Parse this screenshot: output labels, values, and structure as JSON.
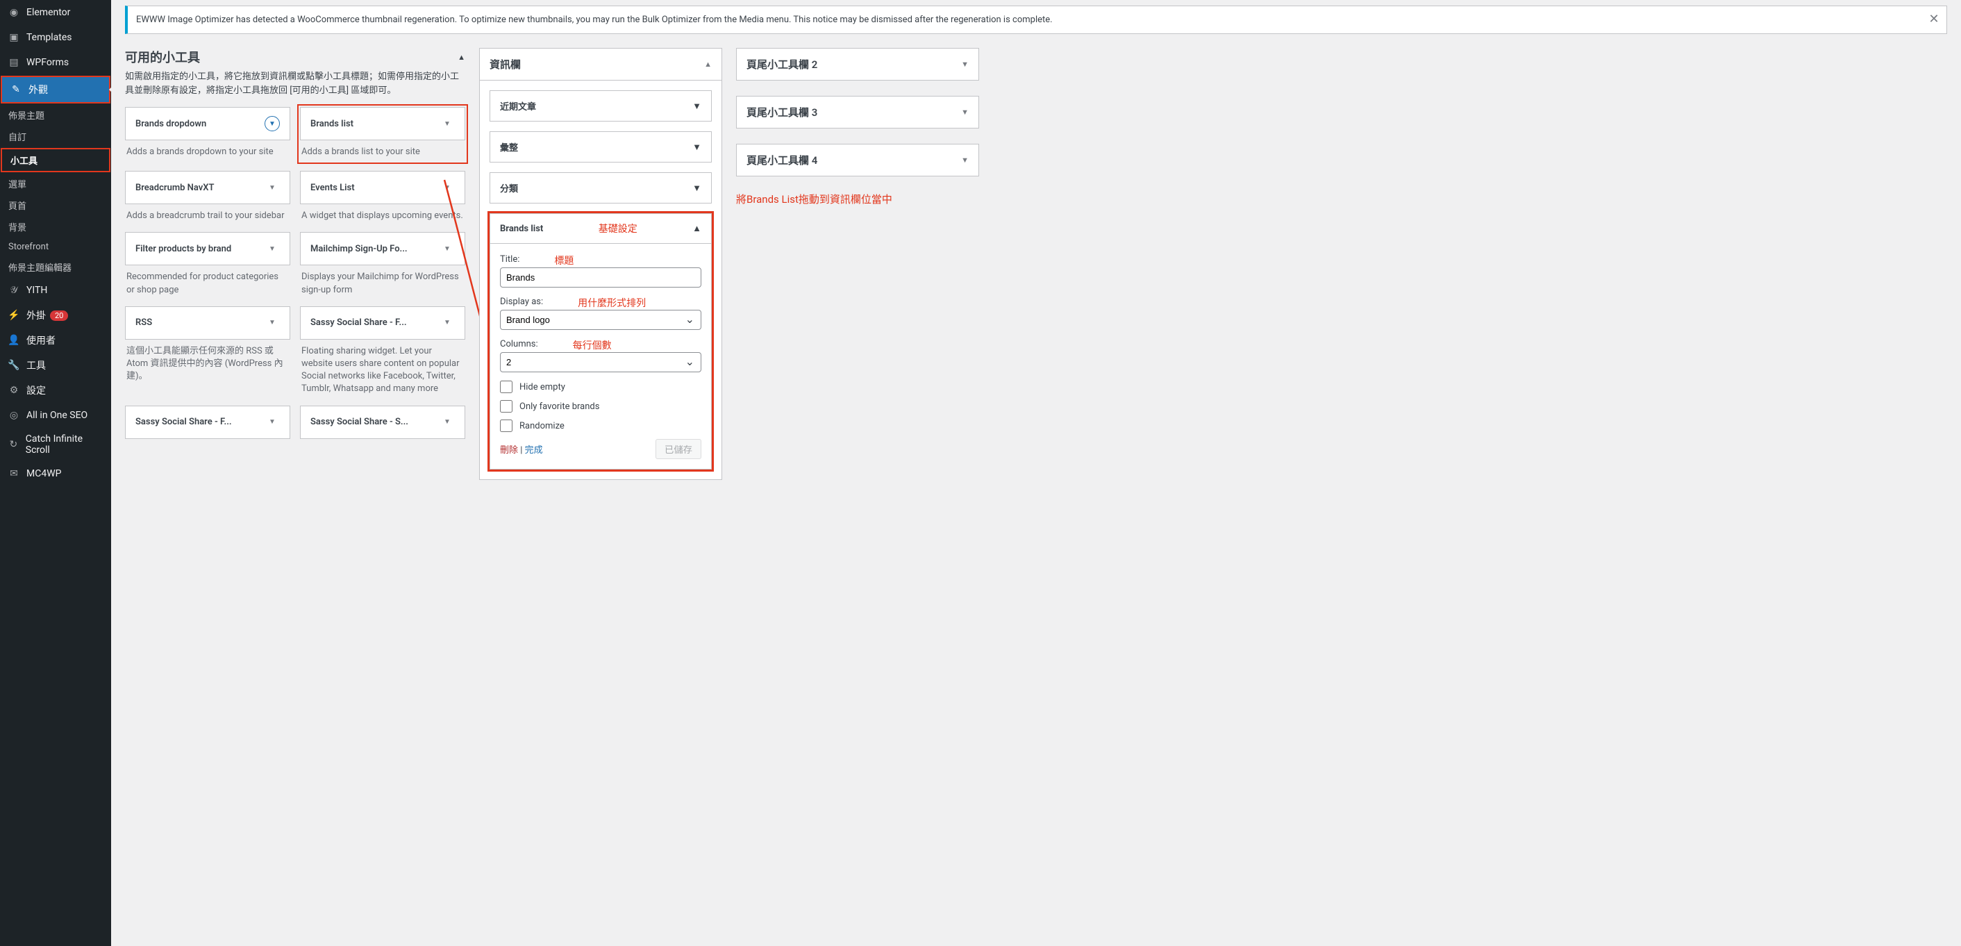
{
  "sidebar": {
    "items": [
      {
        "label": "Elementor",
        "icon": "◉"
      },
      {
        "label": "Templates",
        "icon": "▣"
      },
      {
        "label": "WPForms",
        "icon": "▤"
      }
    ],
    "appearance": {
      "label": "外觀",
      "icon": "✎"
    },
    "appearance_sub": [
      "佈景主題",
      "自訂",
      "小工具",
      "選單",
      "頁首",
      "背景",
      "Storefront",
      "佈景主題編輯器"
    ],
    "tail": [
      {
        "label": "YITH",
        "icon": "𝒴"
      },
      {
        "label": "外掛",
        "icon": "⚡",
        "badge": "20"
      },
      {
        "label": "使用者",
        "icon": "👤"
      },
      {
        "label": "工具",
        "icon": "🔧"
      },
      {
        "label": "設定",
        "icon": "⚙"
      },
      {
        "label": "All in One SEO",
        "icon": "◎"
      },
      {
        "label": "Catch Infinite Scroll",
        "icon": "↻"
      },
      {
        "label": "MC4WP",
        "icon": "✉"
      }
    ]
  },
  "notice": "EWWW Image Optimizer has detected a WooCommerce thumbnail regeneration. To optimize new thumbnails, you may run the Bulk Optimizer from the Media menu. This notice may be dismissed after the regeneration is complete.",
  "available": {
    "title": "可用的小工具",
    "desc": "如需啟用指定的小工具，將它拖放到資訊欄或點擊小工具標題；如需停用指定的小工具並刪除原有設定，將指定小工具拖放回 [可用的小工具] 區域即可。",
    "items": [
      {
        "t": "Brands dropdown",
        "d": "Adds a brands dropdown to your site"
      },
      {
        "t": "Brands list",
        "d": "Adds a brands list to your site"
      },
      {
        "t": "Breadcrumb NavXT",
        "d": "Adds a breadcrumb trail to your sidebar"
      },
      {
        "t": "Events List",
        "d": "A widget that displays upcoming events."
      },
      {
        "t": "Filter products by brand",
        "d": "Recommended for product categories or shop page"
      },
      {
        "t": "Mailchimp Sign-Up Fo...",
        "d": "Displays your Mailchimp for WordPress sign-up form"
      },
      {
        "t": "RSS",
        "d": "這個小工具能顯示任何來源的 RSS 或 Atom 資訊提供中的內容 (WordPress 內建)。"
      },
      {
        "t": "Sassy Social Share - F...",
        "d": "Floating sharing widget. Let your website users share content on popular Social networks like Facebook, Twitter, Tumblr, Whatsapp and many more"
      },
      {
        "t": "Sassy Social Share - F...",
        "d": ""
      },
      {
        "t": "Sassy Social Share - S...",
        "d": ""
      }
    ]
  },
  "infobar": {
    "title": "資訊欄",
    "items": [
      "近期文章",
      "彙整",
      "分類"
    ],
    "open": {
      "title": "Brands list",
      "ann_basic": "基礎設定",
      "lbl_title": "Title:",
      "ann_title": "標題",
      "val_title": "Brands",
      "lbl_display": "Display as:",
      "ann_display": "用什麼形式排列",
      "val_display": "Brand logo",
      "lbl_cols": "Columns:",
      "ann_cols": "每行個數",
      "val_cols": "2",
      "cb1": "Hide empty",
      "cb2": "Only favorite brands",
      "cb3": "Randomize",
      "del": "刪除",
      "done": "完成",
      "saved": "已儲存"
    }
  },
  "footers": [
    "頁尾小工具欄 2",
    "頁尾小工具欄 3",
    "頁尾小工具欄 4"
  ],
  "drag_hint": "將Brands List拖動到資訊欄位當中"
}
